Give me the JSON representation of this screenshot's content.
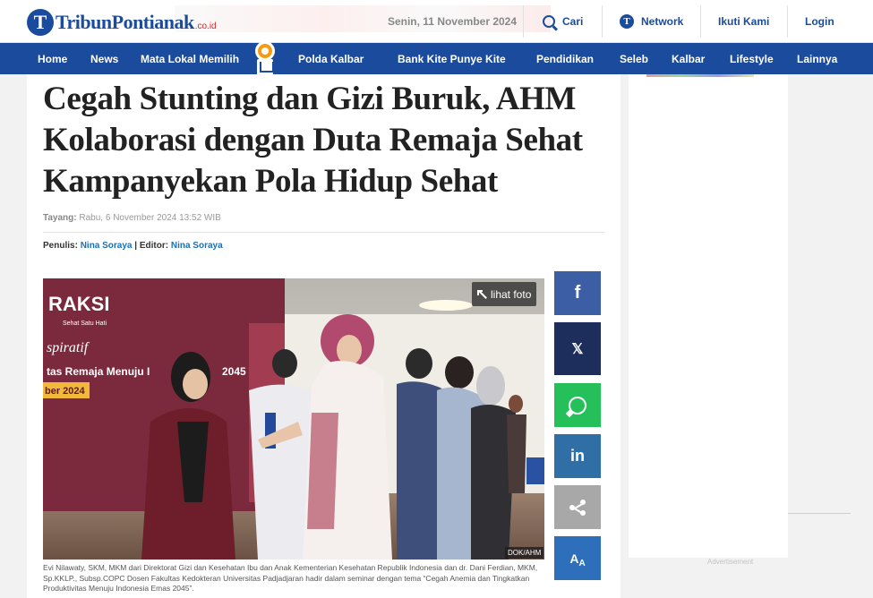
{
  "site": {
    "logo_text": "TribunPontianak",
    "logo_suffix": ".co.id",
    "logo_mark": "T"
  },
  "topbar": {
    "date": "Senin, 11 November 2024",
    "search_label": "Cari",
    "network_label": "Network",
    "follow_label": "Ikuti Kami",
    "login_label": "Login"
  },
  "nav": {
    "items": [
      {
        "label": "Home"
      },
      {
        "label": "News"
      },
      {
        "label": "Mata Lokal Memilih"
      },
      {
        "label": "Polda Kalbar"
      },
      {
        "label": "Bank Kite Punye Kite"
      },
      {
        "label": "Pendidikan"
      },
      {
        "label": "Seleb"
      },
      {
        "label": "Kalbar"
      },
      {
        "label": "Lifestyle"
      },
      {
        "label": "Lainnya"
      }
    ]
  },
  "article": {
    "title": "Cegah Stunting dan Gizi Buruk, AHM Kolaborasi dengan Duta Remaja Sehat Kampanyekan Pola Hidup Sehat",
    "published_label": "Tayang:",
    "published_value": "Rabu, 6 November 2024 13:52 WIB",
    "writer_label": "Penulis:",
    "writer_name": "Nina Soraya",
    "editor_label": "| Editor:",
    "editor_name": "Nina Soraya",
    "photo_button": "lihat foto",
    "photo_credit": "DOK/AHM",
    "banner_text_1": "RAKSI",
    "banner_text_2": "Sehat Satu Hati",
    "banner_text_3": "spiratif",
    "banner_text_4": "tas Remaja Menuju I",
    "banner_text_5": "2045",
    "banner_text_6": "ber 2024",
    "caption": "Evi Nilawaty, SKM, MKM dari Direktorat Gizi dan Kesehatan Ibu dan Anak Kementerian Kesehatan Republik Indonesia dan dr. Dani Ferdian, MKM, Sp.KKLP., Subsp.COPC Dosen Fakultas Kedokteran Universitas Padjadjaran hadir dalam seminar dengan tema “Cegah Anemia dan Tingkatkan Produktivitas Menuju Indonesia Emas 2045”."
  },
  "share": {
    "facebook_icon": "f",
    "x_icon": "𝕏",
    "linkedin_icon": "in",
    "font_icon": "A"
  },
  "sidebar": {
    "advertisement_label": "Advertisement"
  },
  "colors": {
    "brand_blue": "#1a4b9c",
    "facebook": "#3b5ea5",
    "x": "#1d2e5c",
    "whatsapp": "#25c05a",
    "linkedin": "#2f6fa5",
    "share_generic": "#a8a8a8",
    "font_size": "#2d6fbb"
  }
}
